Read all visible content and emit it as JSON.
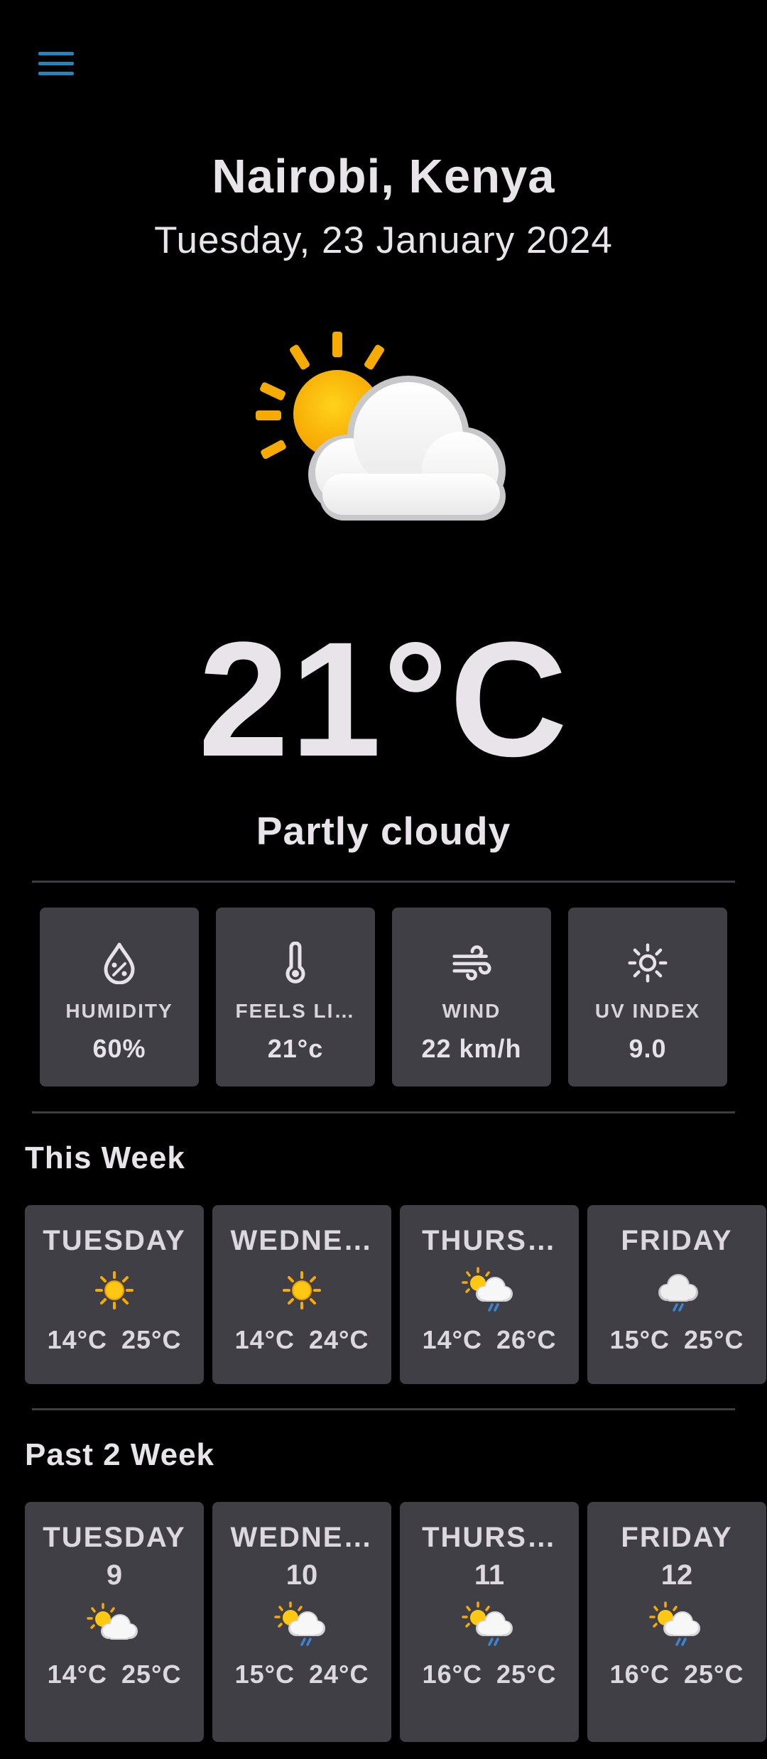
{
  "location": "Nairobi, Kenya",
  "date": "Tuesday, 23 January 2024",
  "current": {
    "icon": "partly-cloudy-icon",
    "temperature": "21°C",
    "condition": "Partly cloudy"
  },
  "stats": [
    {
      "icon": "humidity-icon",
      "label": "HUMIDITY",
      "value": "60%"
    },
    {
      "icon": "thermometer-icon",
      "label": "FEELS LI…",
      "value": "21°c"
    },
    {
      "icon": "wind-icon",
      "label": "WIND",
      "value": "22 km/h"
    },
    {
      "icon": "uv-sun-icon",
      "label": "UV INDEX",
      "value": "9.0"
    }
  ],
  "this_week": {
    "title": "This Week",
    "days": [
      {
        "name": "TUESDAY",
        "icon": "sunny-icon",
        "min": "14°C",
        "max": "25°C"
      },
      {
        "name": "WEDNE…",
        "icon": "sunny-icon",
        "min": "14°C",
        "max": "24°C"
      },
      {
        "name": "THURS…",
        "icon": "sun-rain-cloud-icon",
        "min": "14°C",
        "max": "26°C"
      },
      {
        "name": "FRIDAY",
        "icon": "rain-cloud-icon",
        "min": "15°C",
        "max": "25°C"
      }
    ]
  },
  "past_weeks": {
    "title": "Past 2 Week",
    "days": [
      {
        "name": "TUESDAY",
        "day": "9",
        "icon": "partly-cloudy-icon",
        "min": "14°C",
        "max": "25°C"
      },
      {
        "name": "WEDNE…",
        "day": "10",
        "icon": "sun-rain-cloud-icon",
        "min": "15°C",
        "max": "24°C"
      },
      {
        "name": "THURS…",
        "day": "11",
        "icon": "sun-rain-cloud-icon",
        "min": "16°C",
        "max": "25°C"
      },
      {
        "name": "FRIDAY",
        "day": "12",
        "icon": "sun-rain-cloud-icon",
        "min": "16°C",
        "max": "25°C"
      }
    ]
  },
  "colors": {
    "background": "#000000",
    "card": "#403f46",
    "accent": "#1e86c6",
    "sun": "#f7b500",
    "rain": "#3a86d4"
  }
}
